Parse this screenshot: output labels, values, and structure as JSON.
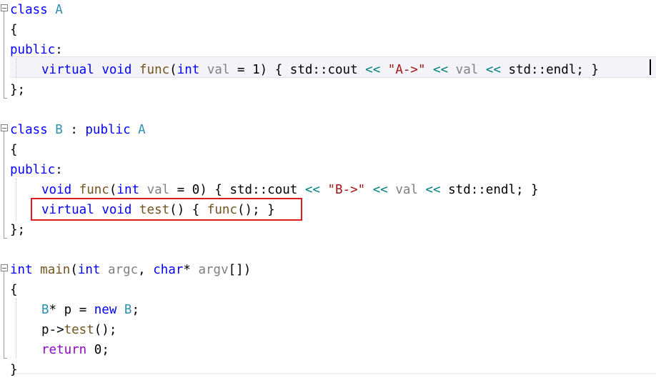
{
  "app": {
    "kind": "code-editor",
    "language": "C++",
    "theme": "light"
  },
  "editor": {
    "current_line_number": 5,
    "caret": {
      "line": 5,
      "at_end_of_line": true
    },
    "colors": {
      "background": "#ffffff",
      "keyword": "#0000ff",
      "type": "#2b91af",
      "function": "#74531f",
      "parameter": "#808080",
      "string": "#a31515",
      "operator": "#008080",
      "return_keyword": "#8f08c4",
      "plain": "#000000",
      "current_line_background": "#f4f4f8",
      "annotation_box": "#e01b1b",
      "fold_marker": "#808080",
      "indent_guide": "#bfbfbf"
    }
  },
  "annotation": {
    "type": "red-rectangle-highlight",
    "target_line": 13,
    "target_text": "virtual void test() { func(); }"
  },
  "fold_markers": [
    {
      "name": "fold-marker-class-a",
      "line": 1,
      "state": "expanded",
      "glyph": "minus-box"
    },
    {
      "name": "fold-marker-class-b",
      "line": 8,
      "state": "expanded",
      "glyph": "minus-box"
    },
    {
      "name": "fold-marker-main",
      "line": 15,
      "state": "expanded",
      "glyph": "minus-box"
    }
  ],
  "code": {
    "lines": [
      {
        "n": 1,
        "indent": 0,
        "tokens": [
          {
            "t": "class",
            "c": "kw"
          },
          {
            "t": " ",
            "c": "pln"
          },
          {
            "t": "A",
            "c": "typ"
          }
        ]
      },
      {
        "n": 2,
        "indent": 0,
        "tokens": [
          {
            "t": "{",
            "c": "pln"
          }
        ]
      },
      {
        "n": 3,
        "indent": 0,
        "tokens": [
          {
            "t": "public",
            "c": "kw"
          },
          {
            "t": ":",
            "c": "pln"
          }
        ]
      },
      {
        "n": 4,
        "indent": 1,
        "tokens": [
          {
            "t": "virtual",
            "c": "kw"
          },
          {
            "t": " ",
            "c": "pln"
          },
          {
            "t": "void",
            "c": "kw"
          },
          {
            "t": " ",
            "c": "pln"
          },
          {
            "t": "func",
            "c": "fn"
          },
          {
            "t": "(",
            "c": "pln"
          },
          {
            "t": "int",
            "c": "kw"
          },
          {
            "t": " ",
            "c": "pln"
          },
          {
            "t": "val",
            "c": "par"
          },
          {
            "t": " = ",
            "c": "pln"
          },
          {
            "t": "1",
            "c": "num"
          },
          {
            "t": ") { ",
            "c": "pln"
          },
          {
            "t": "std::cout",
            "c": "pln"
          },
          {
            "t": " ",
            "c": "pln"
          },
          {
            "t": "<<",
            "c": "op"
          },
          {
            "t": " ",
            "c": "pln"
          },
          {
            "t": "\"A->\"",
            "c": "str"
          },
          {
            "t": " ",
            "c": "pln"
          },
          {
            "t": "<<",
            "c": "op"
          },
          {
            "t": " ",
            "c": "pln"
          },
          {
            "t": "val",
            "c": "par"
          },
          {
            "t": " ",
            "c": "pln"
          },
          {
            "t": "<<",
            "c": "op"
          },
          {
            "t": " ",
            "c": "pln"
          },
          {
            "t": "std::endl; }",
            "c": "pln"
          }
        ]
      },
      {
        "n": 5,
        "indent": 0,
        "tokens": [
          {
            "t": "};",
            "c": "pln"
          }
        ]
      },
      {
        "n": 6,
        "indent": 0,
        "tokens": []
      },
      {
        "n": 7,
        "indent": 0,
        "tokens": [
          {
            "t": "class",
            "c": "kw"
          },
          {
            "t": " ",
            "c": "pln"
          },
          {
            "t": "B",
            "c": "typ"
          },
          {
            "t": " : ",
            "c": "pln"
          },
          {
            "t": "public",
            "c": "kw"
          },
          {
            "t": " ",
            "c": "pln"
          },
          {
            "t": "A",
            "c": "typ"
          }
        ]
      },
      {
        "n": 8,
        "indent": 0,
        "tokens": [
          {
            "t": "{",
            "c": "pln"
          }
        ]
      },
      {
        "n": 9,
        "indent": 0,
        "tokens": [
          {
            "t": "public",
            "c": "kw"
          },
          {
            "t": ":",
            "c": "pln"
          }
        ]
      },
      {
        "n": 10,
        "indent": 1,
        "tokens": [
          {
            "t": "void",
            "c": "kw"
          },
          {
            "t": " ",
            "c": "pln"
          },
          {
            "t": "func",
            "c": "fn"
          },
          {
            "t": "(",
            "c": "pln"
          },
          {
            "t": "int",
            "c": "kw"
          },
          {
            "t": " ",
            "c": "pln"
          },
          {
            "t": "val",
            "c": "par"
          },
          {
            "t": " = ",
            "c": "pln"
          },
          {
            "t": "0",
            "c": "num"
          },
          {
            "t": ") { ",
            "c": "pln"
          },
          {
            "t": "std::cout",
            "c": "pln"
          },
          {
            "t": " ",
            "c": "pln"
          },
          {
            "t": "<<",
            "c": "op"
          },
          {
            "t": " ",
            "c": "pln"
          },
          {
            "t": "\"B->\"",
            "c": "str"
          },
          {
            "t": " ",
            "c": "pln"
          },
          {
            "t": "<<",
            "c": "op"
          },
          {
            "t": " ",
            "c": "pln"
          },
          {
            "t": "val",
            "c": "par"
          },
          {
            "t": " ",
            "c": "pln"
          },
          {
            "t": "<<",
            "c": "op"
          },
          {
            "t": " ",
            "c": "pln"
          },
          {
            "t": "std::endl; }",
            "c": "pln"
          }
        ]
      },
      {
        "n": 11,
        "indent": 1,
        "tokens": [
          {
            "t": "virtual",
            "c": "kw"
          },
          {
            "t": " ",
            "c": "pln"
          },
          {
            "t": "void",
            "c": "kw"
          },
          {
            "t": " ",
            "c": "pln"
          },
          {
            "t": "test",
            "c": "fn"
          },
          {
            "t": "() { ",
            "c": "pln"
          },
          {
            "t": "func",
            "c": "fn"
          },
          {
            "t": "(); }",
            "c": "pln"
          }
        ]
      },
      {
        "n": 12,
        "indent": 0,
        "tokens": [
          {
            "t": "};",
            "c": "pln"
          }
        ]
      },
      {
        "n": 13,
        "indent": 0,
        "tokens": []
      },
      {
        "n": 14,
        "indent": 0,
        "tokens": [
          {
            "t": "int",
            "c": "kw"
          },
          {
            "t": " ",
            "c": "pln"
          },
          {
            "t": "main",
            "c": "fn"
          },
          {
            "t": "(",
            "c": "pln"
          },
          {
            "t": "int",
            "c": "kw"
          },
          {
            "t": " ",
            "c": "pln"
          },
          {
            "t": "argc",
            "c": "par"
          },
          {
            "t": ", ",
            "c": "pln"
          },
          {
            "t": "char",
            "c": "kw"
          },
          {
            "t": "* ",
            "c": "pln"
          },
          {
            "t": "argv",
            "c": "par"
          },
          {
            "t": "[])",
            "c": "pln"
          }
        ]
      },
      {
        "n": 15,
        "indent": 0,
        "tokens": [
          {
            "t": "{",
            "c": "pln"
          }
        ]
      },
      {
        "n": 16,
        "indent": 1,
        "tokens": [
          {
            "t": "B",
            "c": "typ"
          },
          {
            "t": "* p = ",
            "c": "pln"
          },
          {
            "t": "new",
            "c": "kw"
          },
          {
            "t": " ",
            "c": "pln"
          },
          {
            "t": "B",
            "c": "typ"
          },
          {
            "t": ";",
            "c": "pln"
          }
        ]
      },
      {
        "n": 17,
        "indent": 1,
        "tokens": [
          {
            "t": "p->",
            "c": "pln"
          },
          {
            "t": "test",
            "c": "fn"
          },
          {
            "t": "();",
            "c": "pln"
          }
        ]
      },
      {
        "n": 18,
        "indent": 1,
        "tokens": [
          {
            "t": "return",
            "c": "ret"
          },
          {
            "t": " ",
            "c": "pln"
          },
          {
            "t": "0",
            "c": "num"
          },
          {
            "t": ";",
            "c": "pln"
          }
        ]
      },
      {
        "n": 19,
        "indent": 0,
        "tokens": [
          {
            "t": "}",
            "c": "pln"
          }
        ]
      }
    ]
  }
}
